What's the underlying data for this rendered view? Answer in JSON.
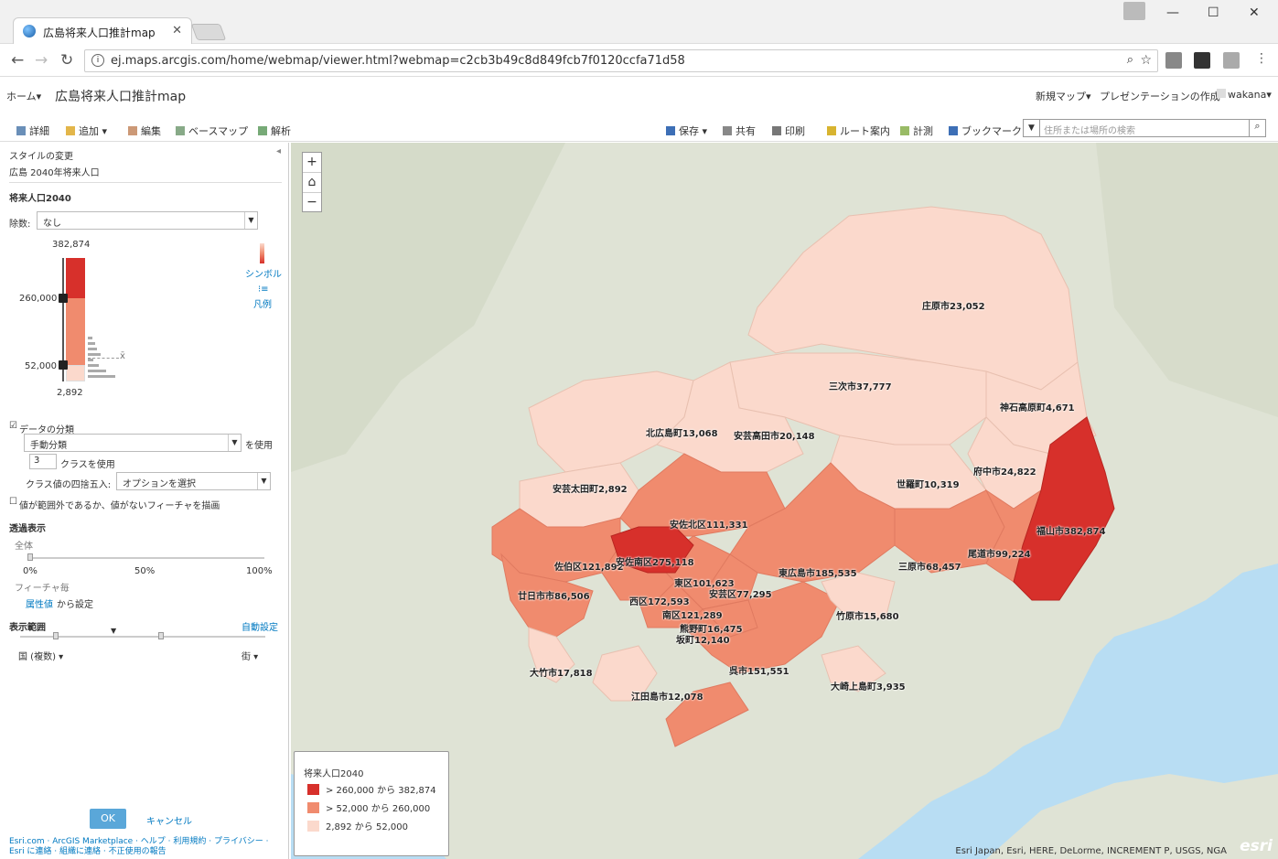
{
  "browser": {
    "tab_title": "広島将来人口推計map",
    "url": "ej.maps.arcgis.com/home/webmap/viewer.html?webmap=c2cb3b49c8d849fcb7f0120ccfa71d58"
  },
  "app": {
    "home": "ホーム▾",
    "title": "広島将来人口推計map",
    "new_map": "新規マップ▾",
    "presentation": "プレゼンテーションの作成",
    "user": "wakana▾"
  },
  "toolbar": {
    "details": "詳細",
    "add": "追加 ▾",
    "edit": "編集",
    "basemap": "ベースマップ",
    "analysis": "解析",
    "save": "保存 ▾",
    "share": "共有",
    "print": "印刷",
    "directions": "ルート案内",
    "measure": "計測",
    "bookmarks": "ブックマーク",
    "search_placeholder": "住所または場所の検索"
  },
  "panel": {
    "header": "スタイルの変更",
    "layer": "広島 2040年将来人口",
    "field": "将来人口2040",
    "divide_label": "除数:",
    "divide_value": "なし",
    "max_value": "382,874",
    "break_high": "260,000",
    "break_low": "52,000",
    "min_value": "2,892",
    "mean_symbol": "x̄",
    "symbol_link": "シンボル",
    "legend_link": "凡例",
    "classify_label": "データの分類",
    "method_value": "手動分類",
    "use_label": "を使用",
    "class_count": "3",
    "class_use_label": "クラスを使用",
    "round_label": "クラス値の四捨五入:",
    "round_value": "オプションを選択",
    "draw_out_of_range": "値が範囲外であるか、値がないフィーチャを描画",
    "transparency_title": "透過表示",
    "transparency_all": "全体",
    "pct0": "0%",
    "pct50": "50%",
    "pct100": "100%",
    "per_feature": "フィーチャ毎",
    "attr_value_link": "属性値",
    "attr_value_suffix": "から設定",
    "visible_range": "表示範囲",
    "auto_set": "自動設定",
    "range_min": "国 (複数) ▾",
    "range_max": "街 ▾",
    "ok": "OK",
    "cancel": "キャンセル",
    "footer_line1": "Esri.com · ArcGIS Marketplace · ヘルプ · 利用規約 · プライバシー · Esri に連絡 · 組織に連絡 · 不正使用の報告"
  },
  "map": {
    "legend_title": "将来人口2040",
    "legend_items": [
      {
        "label": "> 260,000 から 382,874",
        "color": "#d7302b"
      },
      {
        "label": "> 52,000 から 260,000",
        "color": "#f08b6e"
      },
      {
        "label": "2,892 から 52,000",
        "color": "#fbd9cc"
      }
    ],
    "attribution": "Esri Japan, Esri, HERE, DeLorme, INCREMENT P, USGS, NGA",
    "esri_logo": "esri",
    "labels": [
      "庄原市23,052",
      "三次市37,777",
      "神石高原町4,671",
      "北広島町13,068",
      "安芸高田市20,148",
      "府中市24,822",
      "世羅町10,319",
      "安芸太田町2,892",
      "安佐北区111,331",
      "福山市382,874",
      "尾道市99,224",
      "佐伯区121,892",
      "安佐南区275,118",
      "東区101,623",
      "東広島市185,535",
      "三原市68,457",
      "廿日市市86,506",
      "西区172,593",
      "安芸区77,295",
      "南区121,289",
      "竹原市15,680",
      "熊野町16,475",
      "坂町12,140",
      "大竹市17,818",
      "呉市151,551",
      "大崎上島町3,935",
      "江田島市12,078"
    ]
  }
}
